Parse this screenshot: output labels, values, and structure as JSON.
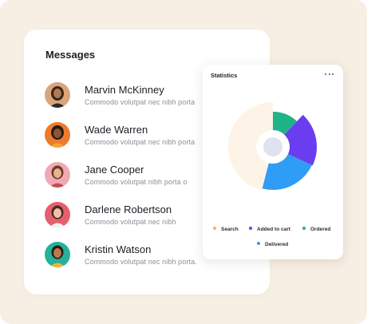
{
  "messages": {
    "title": "Messages",
    "items": [
      {
        "name": "Marvin McKinney",
        "preview": "Commodo volutpat nec nibh porta"
      },
      {
        "name": "Wade Warren",
        "preview": "Commodo volutpat nec nibh porta"
      },
      {
        "name": "Jane Cooper",
        "preview": "Commodo volutpat  nibh porta o"
      },
      {
        "name": "Darlene Robertson",
        "preview": "Commodo volutpat nec nibh"
      },
      {
        "name": "Kristin Watson",
        "preview": "Commodo volutpat nec nibh porta."
      }
    ]
  },
  "statistics": {
    "title": "Statistics",
    "more_icon": "more-horizontal-icon",
    "legend": [
      {
        "label": "Search",
        "color": "#f5b73b"
      },
      {
        "label": "Added to cart",
        "color": "#6a3df0"
      },
      {
        "label": "Ordered",
        "color": "#1fb386"
      },
      {
        "label": "Delivered",
        "color": "#2f9cf5"
      }
    ],
    "segments": [
      {
        "name": "Ordered",
        "fraction": 0.12
      },
      {
        "name": "Added to cart",
        "fraction": 0.2
      },
      {
        "name": "Delivered",
        "fraction": 0.22
      },
      {
        "name": "Search",
        "fraction": 0.46
      }
    ]
  },
  "colors": {
    "background": "#f7efe3",
    "search_segment": "#fdf3e6",
    "center": "#dfe2ef"
  }
}
